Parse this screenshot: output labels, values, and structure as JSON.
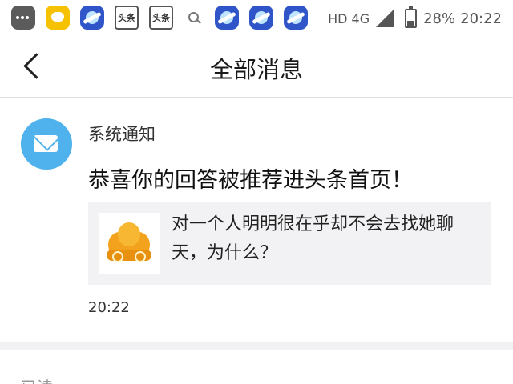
{
  "status_bar": {
    "app_icons": [
      "more-icon",
      "message-icon",
      "planet-icon",
      "toutiao-icon",
      "toutiao-icon",
      "search-icon",
      "planet-icon",
      "planet-icon",
      "planet-icon"
    ],
    "toutiao_label": "头条",
    "network": "HD 4G",
    "battery_percent": "28%",
    "battery_level": 0.28,
    "time": "20:22"
  },
  "nav": {
    "back_icon": "chevron-left-icon",
    "title": "全部消息"
  },
  "notification": {
    "avatar_icon": "mail-icon",
    "avatar_color": "#4fb2ec",
    "sender": "系统通知",
    "headline": "恭喜你的回答被推荐进头条首页！",
    "quote": {
      "thumbnail_icon": "golden-cloud-icon",
      "text": "对一个人明明很在乎却不会去找她聊天，为什么？"
    },
    "time": "20:22"
  },
  "read_section": {
    "title": "已读"
  }
}
